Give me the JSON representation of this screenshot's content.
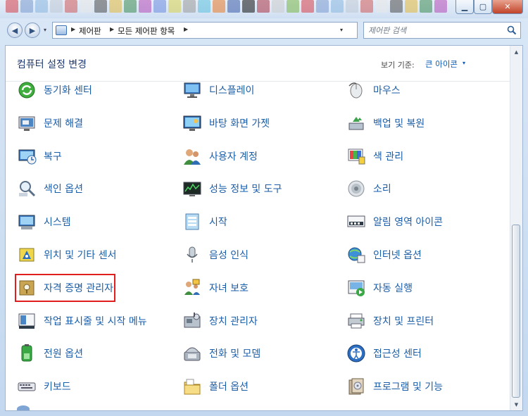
{
  "window": {
    "min_glyph": "▁",
    "max_glyph": "▢",
    "close_glyph": "✕"
  },
  "nav": {
    "back_glyph": "◀",
    "forward_glyph": "▶",
    "dropdown_glyph": "▾"
  },
  "address": {
    "crumbs": [
      "제어판",
      "모든 제어판 항목"
    ],
    "separator_glyph": "▶",
    "dropdown_glyph": "▾",
    "refresh_glyph": "↻"
  },
  "search": {
    "placeholder": "제어판 검색",
    "value": ""
  },
  "header": {
    "title": "컴퓨터 설정 변경",
    "view_by_label": "보기 기준:",
    "view_by_value": "큰 아이콘",
    "view_by_caret": "▾"
  },
  "scrollbar": {
    "up_glyph": "▲",
    "down_glyph": "▼"
  },
  "items": [
    {
      "label": "동기화 센터",
      "icon": "sync-center-icon"
    },
    {
      "label": "디스플레이",
      "icon": "display-icon"
    },
    {
      "label": "마우스",
      "icon": "mouse-icon"
    },
    {
      "label": "문제 해결",
      "icon": "troubleshooting-icon"
    },
    {
      "label": "바탕 화면 가젯",
      "icon": "desktop-gadgets-icon"
    },
    {
      "label": "백업 및 복원",
      "icon": "backup-restore-icon"
    },
    {
      "label": "복구",
      "icon": "recovery-icon"
    },
    {
      "label": "사용자 계정",
      "icon": "user-accounts-icon"
    },
    {
      "label": "색 관리",
      "icon": "color-management-icon"
    },
    {
      "label": "색인 옵션",
      "icon": "indexing-options-icon"
    },
    {
      "label": "성능 정보 및 도구",
      "icon": "performance-icon"
    },
    {
      "label": "소리",
      "icon": "sound-icon"
    },
    {
      "label": "시스템",
      "icon": "system-icon"
    },
    {
      "label": "시작",
      "icon": "getting-started-icon"
    },
    {
      "label": "알림 영역 아이콘",
      "icon": "notification-area-icon"
    },
    {
      "label": "위치 및 기타 센서",
      "icon": "location-sensors-icon"
    },
    {
      "label": "음성 인식",
      "icon": "speech-recognition-icon"
    },
    {
      "label": "인터넷 옵션",
      "icon": "internet-options-icon"
    },
    {
      "label": "자격 증명 관리자",
      "icon": "credential-manager-icon",
      "selected": true
    },
    {
      "label": "자녀 보호",
      "icon": "parental-controls-icon"
    },
    {
      "label": "자동 실행",
      "icon": "autoplay-icon"
    },
    {
      "label": "작업 표시줄 및 시작 메뉴",
      "icon": "taskbar-start-menu-icon"
    },
    {
      "label": "장치 관리자",
      "icon": "device-manager-icon"
    },
    {
      "label": "장치 및 프린터",
      "icon": "devices-printers-icon"
    },
    {
      "label": "전원 옵션",
      "icon": "power-options-icon"
    },
    {
      "label": "전화 및 모뎀",
      "icon": "phone-modem-icon"
    },
    {
      "label": "접근성 센터",
      "icon": "ease-of-access-icon"
    },
    {
      "label": "키보드",
      "icon": "keyboard-icon"
    },
    {
      "label": "폴더 옵션",
      "icon": "folder-options-icon"
    },
    {
      "label": "프로그램 및 기능",
      "icon": "programs-features-icon"
    }
  ]
}
